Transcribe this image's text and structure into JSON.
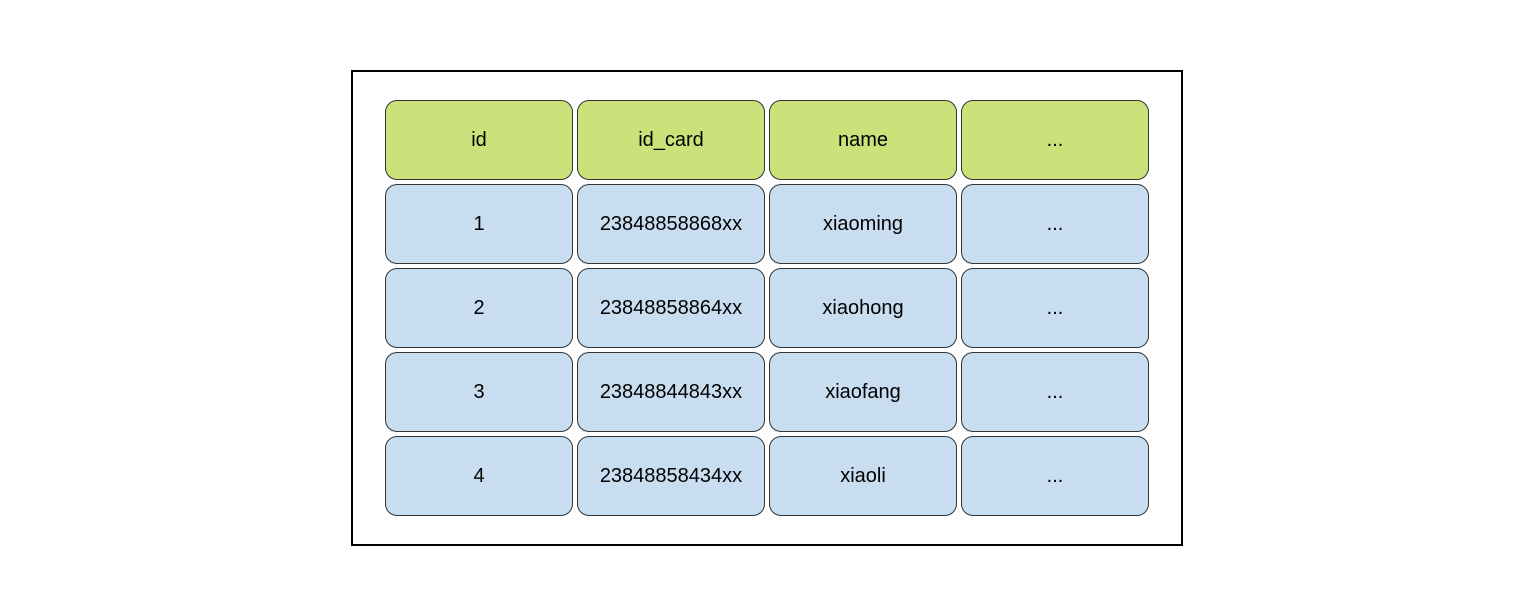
{
  "chart_data": {
    "type": "table",
    "headers": [
      "id",
      "id_card",
      "name",
      "..."
    ],
    "rows": [
      [
        "1",
        "23848858868xx",
        "xiaoming",
        "..."
      ],
      [
        "2",
        "23848858864xx",
        "xiaohong",
        "..."
      ],
      [
        "3",
        "23848844843xx",
        "xiaofang",
        "..."
      ],
      [
        "4",
        "23848858434xx",
        "xiaoli",
        "..."
      ]
    ]
  }
}
